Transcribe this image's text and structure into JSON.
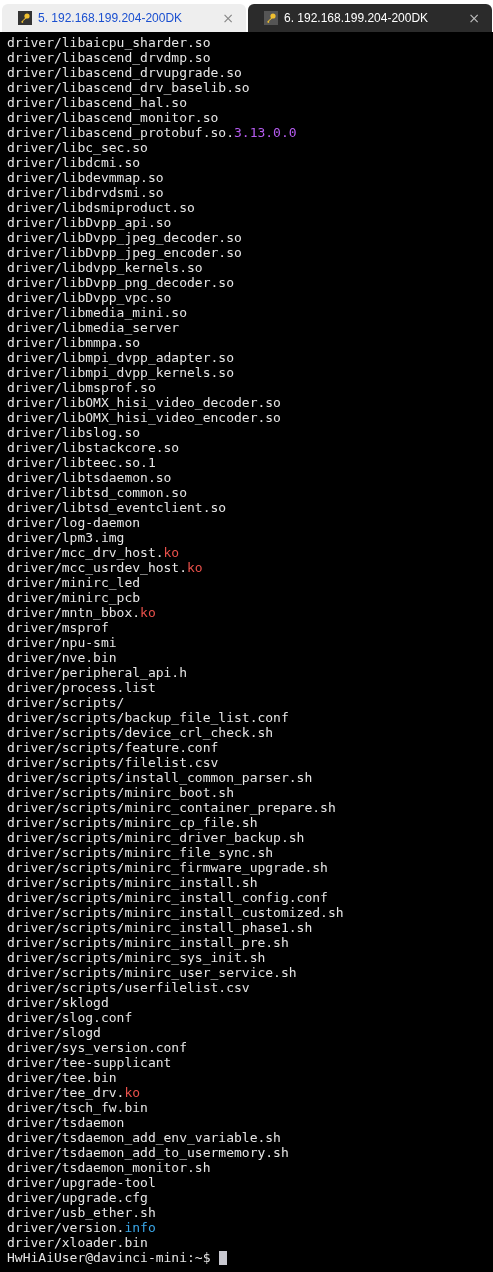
{
  "tabs": [
    {
      "label": "5. 192.168.199.204-200DK",
      "close": "×",
      "selected": false
    },
    {
      "label": "6. 192.168.199.204-200DK",
      "close": "×",
      "selected": true
    }
  ],
  "terminal": {
    "lines": [
      {
        "text": "driver/libaicpu_sharder.so"
      },
      {
        "text": "driver/libascend_drvdmp.so"
      },
      {
        "text": "driver/libascend_drvupgrade.so"
      },
      {
        "text": "driver/libascend_drv_baselib.so"
      },
      {
        "text": "driver/libascend_hal.so"
      },
      {
        "text": "driver/libascend_monitor.so"
      },
      {
        "text": "driver/libascend_protobuf.so.",
        "highlight": {
          "text": "3.13.0.0",
          "color": "#b65cf0"
        }
      },
      {
        "text": "driver/libc_sec.so"
      },
      {
        "text": "driver/libdcmi.so"
      },
      {
        "text": "driver/libdevmmap.so"
      },
      {
        "text": "driver/libdrvdsmi.so"
      },
      {
        "text": "driver/libdsmiproduct.so"
      },
      {
        "text": "driver/libDvpp_api.so"
      },
      {
        "text": "driver/libDvpp_jpeg_decoder.so"
      },
      {
        "text": "driver/libDvpp_jpeg_encoder.so"
      },
      {
        "text": "driver/libdvpp_kernels.so"
      },
      {
        "text": "driver/libDvpp_png_decoder.so"
      },
      {
        "text": "driver/libDvpp_vpc.so"
      },
      {
        "text": "driver/libmedia_mini.so"
      },
      {
        "text": "driver/libmedia_server"
      },
      {
        "text": "driver/libmmpa.so"
      },
      {
        "text": "driver/libmpi_dvpp_adapter.so"
      },
      {
        "text": "driver/libmpi_dvpp_kernels.so"
      },
      {
        "text": "driver/libmsprof.so"
      },
      {
        "text": "driver/libOMX_hisi_video_decoder.so"
      },
      {
        "text": "driver/libOMX_hisi_video_encoder.so"
      },
      {
        "text": "driver/libslog.so"
      },
      {
        "text": "driver/libstackcore.so"
      },
      {
        "text": "driver/libteec.so.1"
      },
      {
        "text": "driver/libtsdaemon.so"
      },
      {
        "text": "driver/libtsd_common.so"
      },
      {
        "text": "driver/libtsd_eventclient.so"
      },
      {
        "text": "driver/log-daemon"
      },
      {
        "text": "driver/lpm3.img"
      },
      {
        "text": "driver/mcc_drv_host.",
        "highlight": {
          "text": "ko",
          "color": "#e8504a"
        }
      },
      {
        "text": "driver/mcc_usrdev_host.",
        "highlight": {
          "text": "ko",
          "color": "#e8504a"
        }
      },
      {
        "text": "driver/minirc_led"
      },
      {
        "text": "driver/minirc_pcb"
      },
      {
        "text": "driver/mntn_bbox.",
        "highlight": {
          "text": "ko",
          "color": "#e8504a"
        }
      },
      {
        "text": "driver/msprof"
      },
      {
        "text": "driver/npu-smi"
      },
      {
        "text": "driver/nve.bin"
      },
      {
        "text": "driver/peripheral_api.h"
      },
      {
        "text": "driver/process.list"
      },
      {
        "text": "driver/scripts/"
      },
      {
        "text": "driver/scripts/backup_file_list.conf"
      },
      {
        "text": "driver/scripts/device_crl_check.sh"
      },
      {
        "text": "driver/scripts/feature.conf"
      },
      {
        "text": "driver/scripts/filelist.csv"
      },
      {
        "text": "driver/scripts/install_common_parser.sh"
      },
      {
        "text": "driver/scripts/minirc_boot.sh"
      },
      {
        "text": "driver/scripts/minirc_container_prepare.sh"
      },
      {
        "text": "driver/scripts/minirc_cp_file.sh"
      },
      {
        "text": "driver/scripts/minirc_driver_backup.sh"
      },
      {
        "text": "driver/scripts/minirc_file_sync.sh"
      },
      {
        "text": "driver/scripts/minirc_firmware_upgrade.sh"
      },
      {
        "text": "driver/scripts/minirc_install.sh"
      },
      {
        "text": "driver/scripts/minirc_install_config.conf"
      },
      {
        "text": "driver/scripts/minirc_install_customized.sh"
      },
      {
        "text": "driver/scripts/minirc_install_phase1.sh"
      },
      {
        "text": "driver/scripts/minirc_install_pre.sh"
      },
      {
        "text": "driver/scripts/minirc_sys_init.sh"
      },
      {
        "text": "driver/scripts/minirc_user_service.sh"
      },
      {
        "text": "driver/scripts/userfilelist.csv"
      },
      {
        "text": "driver/sklogd"
      },
      {
        "text": "driver/slog.conf"
      },
      {
        "text": "driver/slogd"
      },
      {
        "text": "driver/sys_version.conf"
      },
      {
        "text": "driver/tee-supplicant"
      },
      {
        "text": "driver/tee.bin"
      },
      {
        "text": "driver/tee_drv.",
        "highlight": {
          "text": "ko",
          "color": "#e8504a"
        }
      },
      {
        "text": "driver/tsch_fw.bin"
      },
      {
        "text": "driver/tsdaemon"
      },
      {
        "text": "driver/tsdaemon_add_env_variable.sh"
      },
      {
        "text": "driver/tsdaemon_add_to_usermemory.sh"
      },
      {
        "text": "driver/tsdaemon_monitor.sh"
      },
      {
        "text": "driver/upgrade-tool"
      },
      {
        "text": "driver/upgrade.cfg"
      },
      {
        "text": "driver/usb_ether.sh"
      },
      {
        "text": "driver/version.",
        "highlight": {
          "text": "info",
          "color": "#3aa7e8"
        }
      },
      {
        "text": "driver/xloader.bin"
      }
    ],
    "prompt": "HwHiAiUser@davinci-mini:~$"
  }
}
